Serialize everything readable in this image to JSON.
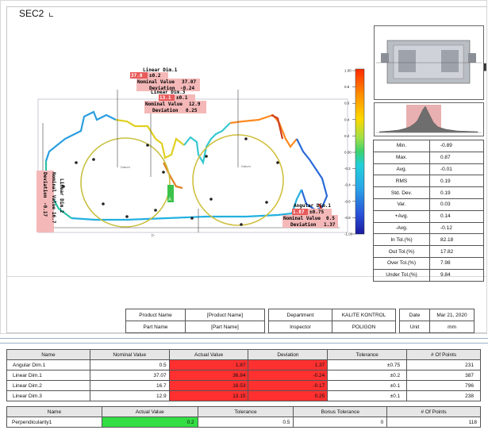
{
  "section_title": "SEC2",
  "colorbar": {
    "labels": [
      "1.00",
      "0.8",
      "0.6",
      "0.4",
      "0.2",
      "0.00",
      "-0.2",
      "-0.4",
      "-0.6",
      "-0.8",
      "-1.00"
    ]
  },
  "callouts": {
    "linear_dim1": {
      "title": "Linear Dim.1",
      "nominal_label": "Nominal Value",
      "nominal": "37.07",
      "deviation_label": "Deviation",
      "deviation": "-0.24",
      "measured": "37.0",
      "tol": "±0.2"
    },
    "linear_dim3": {
      "title": "Linear Dim.3",
      "nominal_label": "Nominal Value",
      "nominal": "12.9",
      "deviation_label": "Deviation",
      "deviation": "0.25",
      "measured": "13.1",
      "tol": "±0.1"
    },
    "linear_dim2": {
      "title": "Linear Dim.2",
      "nominal_label": "Nominal Value",
      "nominal": "16.7",
      "deviation_label": "Deviation",
      "deviation": "-0.17"
    },
    "angular_dim1": {
      "title": "Angular Dim.1",
      "nominal_label": "Nominal Value",
      "nominal": "0.5",
      "deviation_label": "Deviation",
      "deviation": "1.37",
      "measured": "1.87",
      "tol": "±0.75"
    }
  },
  "datum_a": "A",
  "stats": [
    {
      "key": "Min.",
      "value": "-0.89"
    },
    {
      "key": "Max.",
      "value": "0.87"
    },
    {
      "key": "Avg.",
      "value": "-0.01"
    },
    {
      "key": "RMS",
      "value": "0.19"
    },
    {
      "key": "Std. Dev.",
      "value": "0.19"
    },
    {
      "key": "Var.",
      "value": "0.03"
    },
    {
      "key": "+Avg.",
      "value": "0.14"
    },
    {
      "key": "-Avg.",
      "value": "-0.12"
    },
    {
      "key": "In Tol.(%)",
      "value": "82.18"
    },
    {
      "key": "Out Tol.(%)",
      "value": "17.82"
    },
    {
      "key": "Over Tol.(%)",
      "value": "7.98"
    },
    {
      "key": "Under Tol.(%)",
      "value": "9.84"
    }
  ],
  "info": {
    "product_name_label": "Product Name",
    "product_name_value": "[Product Name]",
    "part_name_label": "Part Name",
    "part_name_value": "[Part Name]",
    "department_label": "Department",
    "department_value": "KALITE KONTROL",
    "inspector_label": "Inspector",
    "inspector_value": "POLIGON",
    "date_label": "Date",
    "date_value": "Mar 21, 2020",
    "unit_label": "Unit",
    "unit_value": "mm"
  },
  "results": {
    "headers": [
      "Name",
      "Nominal Value",
      "Actual Value",
      "Deviation",
      "Tolerance",
      "# Of Points"
    ],
    "rows": [
      {
        "name": "Angular Dim.1",
        "nominal": "0.5",
        "actual": "1.87",
        "deviation": "1.37",
        "tolerance": "±0.75",
        "points": "231"
      },
      {
        "name": "Linear Dim.1",
        "nominal": "37.07",
        "actual": "36.84",
        "deviation": "-0.24",
        "tolerance": "±0.2",
        "points": "387"
      },
      {
        "name": "Linear Dim.2",
        "nominal": "16.7",
        "actual": "16.53",
        "deviation": "-0.17",
        "tolerance": "±0.1",
        "points": "796"
      },
      {
        "name": "Linear Dim.3",
        "nominal": "12.9",
        "actual": "13.15",
        "deviation": "0.25",
        "tolerance": "±0.1",
        "points": "238"
      }
    ]
  },
  "gdt": {
    "headers": [
      "Name",
      "Actual Value",
      "Tolerance",
      "Bonus Tolerance",
      "# Of Points"
    ],
    "row": {
      "name": "Perpendicularity1",
      "actual": "0.2",
      "tolerance": "0.5",
      "bonus": "0",
      "points": "118"
    }
  }
}
